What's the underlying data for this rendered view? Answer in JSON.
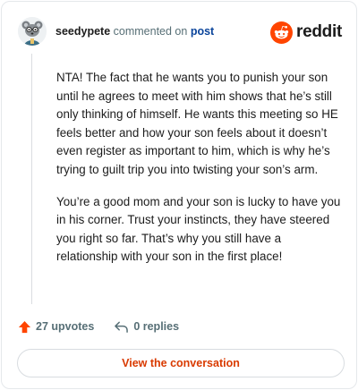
{
  "header": {
    "username": "seedypete",
    "action_text": "commented on",
    "post_link": "post",
    "brand_name": "reddit"
  },
  "comment": {
    "paragraphs": [
      "NTA! The fact that he wants you to punish your son until he agrees to meet with him shows that he’s still only thinking of himself. He wants this meeting so HE feels better and how your son feels about it doesn’t even register as important to him, which is why he’s trying to guilt trip you into twisting your son’s arm.",
      "You’re a good mom and your son is lucky to have you in his corner. Trust your instincts, they have steered you right so far. That’s why you still have a relationship with your son in the first place!"
    ]
  },
  "actions": {
    "upvotes_label": "27 upvotes",
    "replies_label": "0 replies"
  },
  "cta": {
    "label": "View the conversation"
  },
  "colors": {
    "brand_orange": "#ff4500",
    "upvote_orange": "#ff4500",
    "link_blue": "#0a449b",
    "cta_text": "#d93a00",
    "muted": "#576f76"
  },
  "icons": {
    "avatar": "avatar",
    "brand": "reddit-logo-icon",
    "upvote": "upvote-arrow-icon",
    "reply": "reply-arrow-icon"
  }
}
